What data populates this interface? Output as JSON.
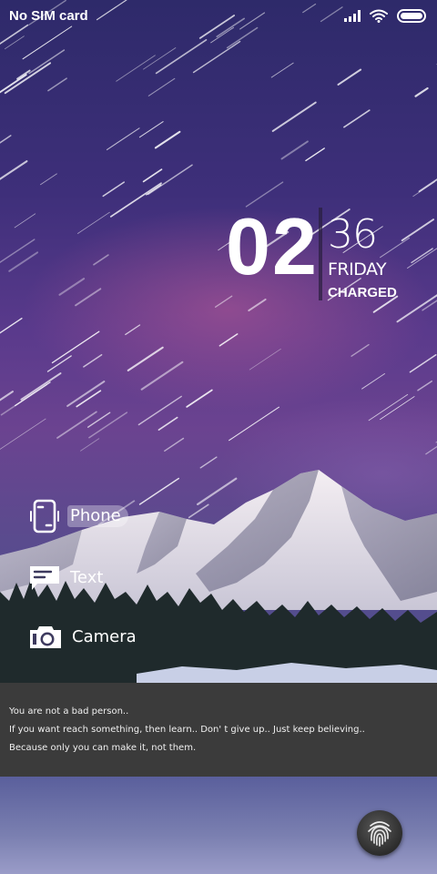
{
  "status_bar": {
    "carrier": "No SIM card",
    "icons": [
      "signal-icon",
      "wifi-icon",
      "battery-icon"
    ]
  },
  "clock": {
    "hour": "02",
    "minute": "36",
    "weekday": "FRIDAY",
    "charge_status": "CHARGED"
  },
  "shortcuts": [
    {
      "label": "Phone",
      "icon": "phone-icon"
    },
    {
      "label": "Text",
      "icon": "message-icon"
    },
    {
      "label": "Camera",
      "icon": "camera-icon"
    }
  ],
  "quote": {
    "lines": [
      "You are not a bad person..",
      "If you want reach something, then learn.. Don' t give up.. Just keep believing..",
      "Because only you can make it, not them."
    ]
  },
  "fingerprint": {
    "icon": "fingerprint-icon"
  },
  "colors": {
    "quote_panel": "#3b3b3b",
    "sky_top": "#2e2a6a",
    "sky_mid": "#6b4390"
  }
}
